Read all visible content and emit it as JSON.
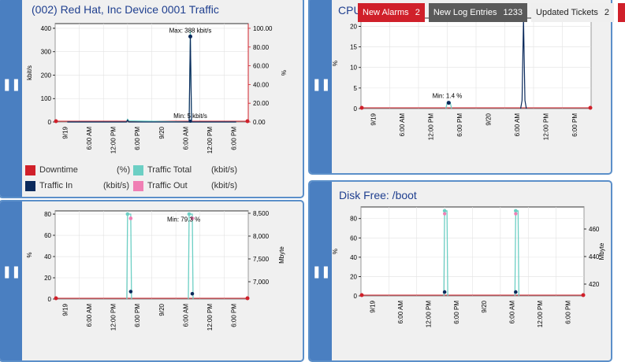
{
  "panels": {
    "traffic": {
      "title": "(002) Red Hat, Inc Device 0001 Traffic",
      "yleft_label": "kbit/s",
      "yright_label": "%",
      "yleft_ticks": [
        "400",
        "300",
        "200",
        "100",
        "0"
      ],
      "yright_ticks": [
        "100.00",
        "80.00",
        "60.00",
        "40.00",
        "20.00",
        "0.00"
      ],
      "max_label": "Max: 388 kbit/s",
      "min_label": "Min: 5 kbit/s",
      "legend": [
        {
          "name": "Downtime",
          "unit": "(%)",
          "color": "#d0202a"
        },
        {
          "name": "Traffic Total",
          "unit": "(kbit/s)",
          "color": "#6ccfc4"
        },
        {
          "name": "Traffic In",
          "unit": "(kbit/s)",
          "color": "#0b2a5c"
        },
        {
          "name": "Traffic Out",
          "unit": "(kbit/s)",
          "color": "#f07fb4"
        }
      ]
    },
    "cpu": {
      "title": "CPU",
      "yleft_label": "%",
      "yleft_ticks": [
        "20",
        "15",
        "10",
        "5",
        "0"
      ],
      "min_label": "Min: 1.4 %"
    },
    "memory": {
      "yleft_label": "%",
      "yright_label": "Mbyte",
      "yleft_ticks": [
        "80",
        "60",
        "40",
        "20",
        "0"
      ],
      "yright_ticks": [
        "8,500",
        "8,000",
        "7,500",
        "7,000"
      ],
      "min_label": "Min: 79.3 %"
    },
    "disk": {
      "title": "Disk Free: /boot",
      "yleft_label": "%",
      "yright_label": "Mbyte",
      "yleft_ticks": [
        "80",
        "60",
        "40",
        "20",
        "0"
      ],
      "yright_ticks": [
        "460",
        "440",
        "420"
      ]
    }
  },
  "xticks": [
    "9/19",
    "6:00 AM",
    "12:00 PM",
    "6:00 PM",
    "9/20",
    "6:00 AM",
    "12:00 PM",
    "6:00 PM"
  ],
  "xticks_cpu": [
    "9/19",
    "6:00 AM",
    "12:00 PM",
    "6:00 PM",
    "9/20",
    "6:00 AM",
    "12:00 PM",
    "6:00 PM"
  ],
  "badges": [
    {
      "label": "New Alarms",
      "count": "2",
      "bg": "#d0202a",
      "fg": "#ffffff"
    },
    {
      "label": "New Log Entries",
      "count": "1233",
      "bg": "#5a5a5a",
      "fg": "#ffffff"
    },
    {
      "label": "Updated Tickets",
      "count": "2",
      "bg": "#efefef",
      "fg": "#222222"
    }
  ],
  "colors": {
    "downtime": "#d0202a",
    "total": "#6ccfc4",
    "in": "#0b2a5c",
    "out": "#f07fb4",
    "accent": "#4a7fc1"
  },
  "chart_data": [
    {
      "type": "line",
      "title": "(002) Red Hat, Inc Device 0001 Traffic",
      "ylabel": "kbit/s",
      "y2label": "%",
      "ylim": [
        0,
        420
      ],
      "y2lim": [
        0,
        105
      ],
      "x": [
        "9/19",
        "6:00 AM",
        "12:00 PM",
        "6:00 PM",
        "9/20",
        "6:00 AM",
        "12:00 PM",
        "6:00 PM"
      ],
      "series": [
        {
          "name": "Traffic Total",
          "points": [
            [
              0.5,
              0
            ],
            [
              2.95,
              0
            ],
            [
              3.0,
              12
            ],
            [
              3.05,
              5
            ],
            [
              5.55,
              0
            ],
            [
              5.6,
              388
            ],
            [
              5.65,
              0
            ],
            [
              7.5,
              0
            ]
          ]
        },
        {
          "name": "Traffic In",
          "points": [
            [
              0.5,
              0
            ],
            [
              2.95,
              0
            ],
            [
              3.0,
              8
            ],
            [
              3.05,
              0
            ],
            [
              5.55,
              0
            ],
            [
              5.6,
              365
            ],
            [
              5.65,
              0
            ],
            [
              7.5,
              0
            ]
          ]
        },
        {
          "name": "Downtime",
          "values_pct": [
            0,
            0
          ]
        }
      ],
      "annotations": [
        "Max: 388 kbit/s",
        "Min: 5 kbit/s"
      ]
    },
    {
      "type": "line",
      "title": "CPU",
      "ylabel": "%",
      "ylim": [
        0,
        22
      ],
      "annotations": [
        "Min: 1.4 %"
      ]
    },
    {
      "type": "line",
      "ylabel": "%",
      "y2label": "Mbyte",
      "ylim": [
        0,
        83
      ],
      "annotations": [
        "Min: 79.3 %"
      ]
    },
    {
      "type": "line",
      "title": "Disk Free: /boot",
      "ylabel": "%",
      "y2label": "Mbyte",
      "ylim": [
        0,
        92
      ]
    }
  ]
}
